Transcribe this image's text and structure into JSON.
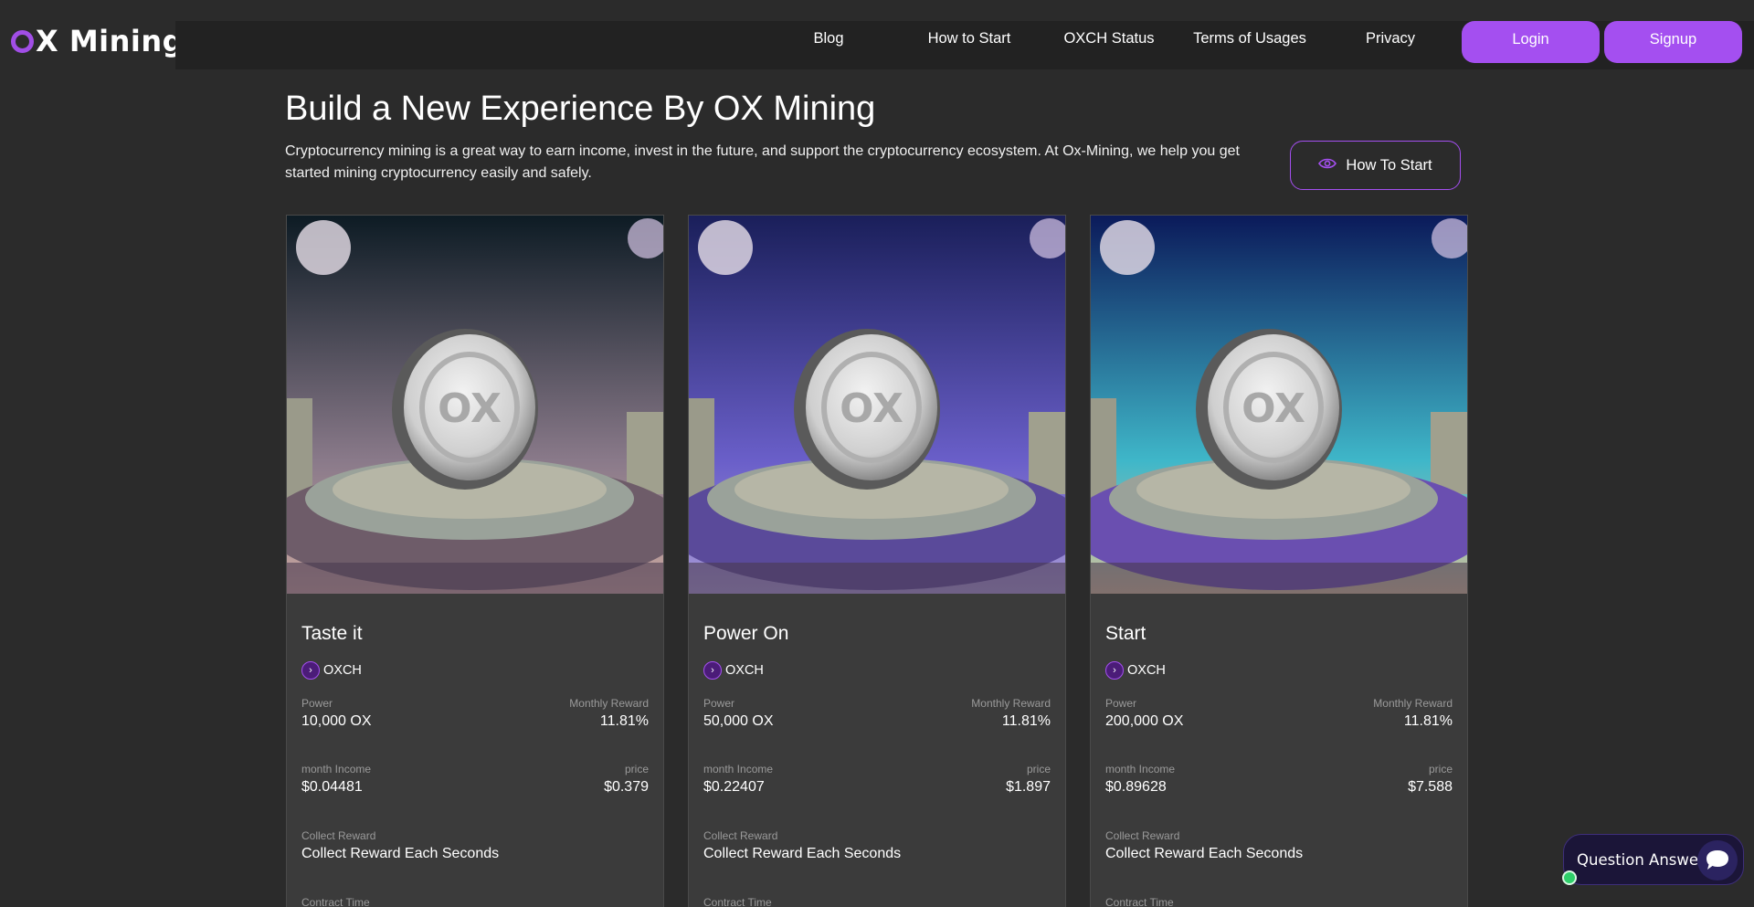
{
  "logo": {
    "text": "X Mining"
  },
  "nav": {
    "items": [
      "Blog",
      "How to Start",
      "OXCH Status",
      "Terms of Usages",
      "Privacy"
    ],
    "login": "Login",
    "signup": "Signup"
  },
  "hero": {
    "title": "Build a New Experience By OX Mining",
    "description": "Cryptocurrency mining is a great way to earn income, invest in the future, and support the cryptocurrency ecosystem. At Ox-Mining, we help you get started mining cryptocurrency easily and safely.",
    "button": "How To Start",
    "button_icon": "eye-icon"
  },
  "labels": {
    "power": "Power",
    "monthly_reward": "Monthly Reward",
    "month_income": "month Income",
    "price": "price",
    "collect_reward": "Collect Reward",
    "contract_time": "Contract Time"
  },
  "cards": [
    {
      "title": "Taste it",
      "coin": "OXCH",
      "power": "10,000 OX",
      "monthly_reward": "11.81%",
      "month_income": "$0.04481",
      "price": "$0.379",
      "collect": "Collect Reward Each Seconds"
    },
    {
      "title": "Power On",
      "coin": "OXCH",
      "power": "50,000 OX",
      "monthly_reward": "11.81%",
      "month_income": "$0.22407",
      "price": "$1.897",
      "collect": "Collect Reward Each Seconds"
    },
    {
      "title": "Start",
      "coin": "OXCH",
      "power": "200,000 OX",
      "monthly_reward": "11.81%",
      "month_income": "$0.89628",
      "price": "$7.588",
      "collect": "Collect Reward Each Seconds"
    }
  ],
  "chat": {
    "label": "Question Answer",
    "icon": "chat-bubble-icon"
  },
  "colors": {
    "accent": "#a44ff0",
    "background": "#2b2b2b",
    "card": "#3b3b3b",
    "nav": "#222222"
  }
}
